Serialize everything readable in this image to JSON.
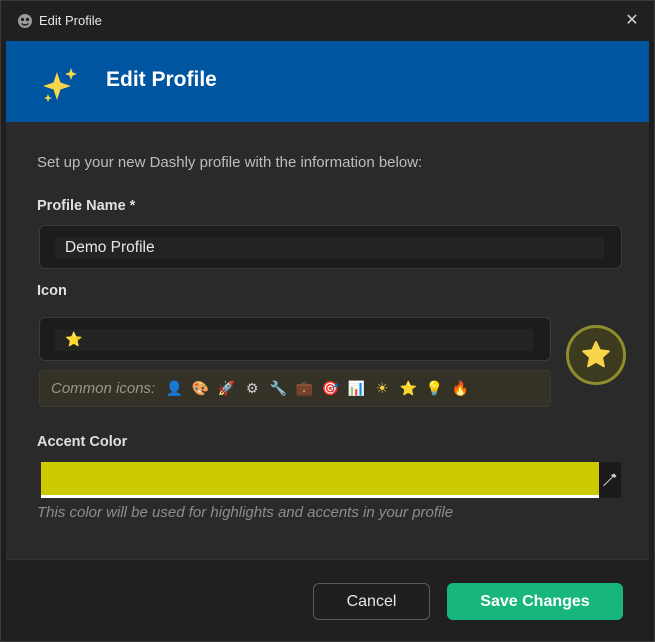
{
  "window": {
    "title": "Edit Profile",
    "close_glyph": "✕"
  },
  "banner": {
    "title": "Edit Profile",
    "icon": "sparkles-icon"
  },
  "intro": "Set up your new Dashly profile with the information below:",
  "profile_name": {
    "label": "Profile Name *",
    "value": "Demo Profile"
  },
  "icon_field": {
    "label": "Icon",
    "value": "⭐"
  },
  "common_icons": {
    "label": "Common icons:",
    "items": [
      "👤",
      "🎨",
      "🚀",
      "⚙",
      "🔧",
      "💼",
      "🎯",
      "📊",
      "☀",
      "⭐",
      "💡",
      "🔥"
    ]
  },
  "accent_color": {
    "label": "Accent Color",
    "value": "#cdcb00",
    "hint": "This color will be used for highlights and accents in your profile"
  },
  "buttons": {
    "cancel": "Cancel",
    "save": "Save Changes"
  },
  "colors": {
    "banner": "#0055a1",
    "save": "#17b67d",
    "accent": "#cdcb00"
  }
}
